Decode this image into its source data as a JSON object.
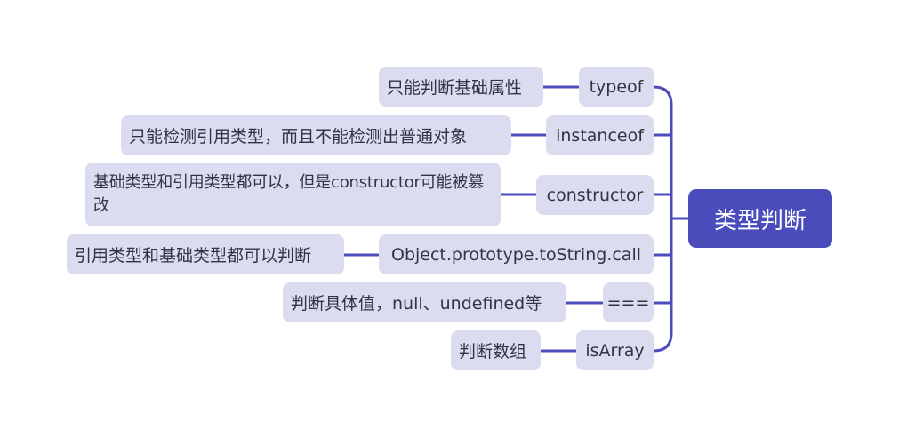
{
  "root": {
    "label": "类型判断"
  },
  "methods": [
    {
      "label": "typeof",
      "desc": "只能判断基础属性"
    },
    {
      "label": "instanceof",
      "desc": "只能检测引用类型，而且不能检测出普通对象"
    },
    {
      "label": "constructor",
      "desc": "基础类型和引用类型都可以，但是constructor可能被篡改"
    },
    {
      "label": "Object.prototype.toString.call",
      "desc": "引用类型和基础类型都可以判断"
    },
    {
      "label": "===",
      "desc": "判断具体值，null、undefined等"
    },
    {
      "label": "isArray",
      "desc": "判断数组"
    }
  ],
  "colors": {
    "accent": "#4a4cbc",
    "node_bg": "#dcdcf0"
  }
}
